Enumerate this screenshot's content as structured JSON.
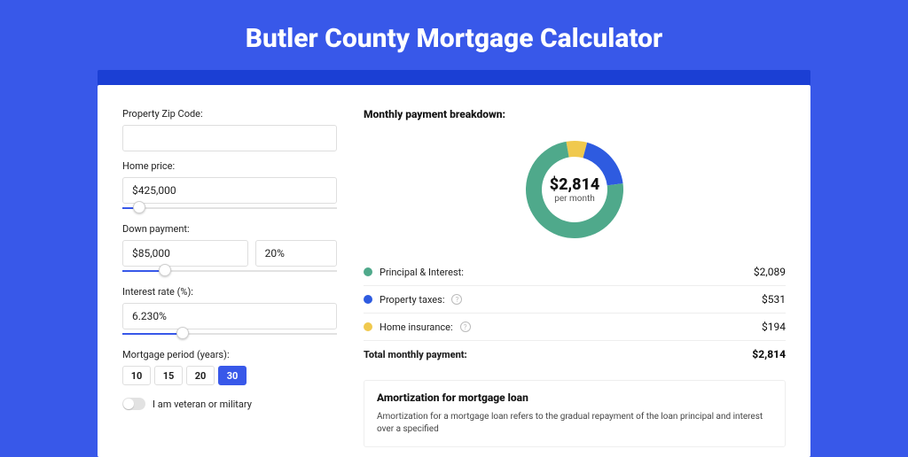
{
  "title": "Butler County Mortgage Calculator",
  "left": {
    "zip_label": "Property Zip Code:",
    "zip_value": "",
    "home_price_label": "Home price:",
    "home_price_value": "$425,000",
    "home_price_slider_pct": 8,
    "down_payment_label": "Down payment:",
    "down_payment_value": "$85,000",
    "down_payment_pct_value": "20%",
    "down_payment_slider_pct": 20,
    "rate_label": "Interest rate (%):",
    "rate_value": "6.230%",
    "rate_slider_pct": 28,
    "period_label": "Mortgage period (years):",
    "periods": [
      {
        "label": "10",
        "active": false
      },
      {
        "label": "15",
        "active": false
      },
      {
        "label": "20",
        "active": false
      },
      {
        "label": "30",
        "active": true
      }
    ],
    "veteran_label": "I am veteran or military"
  },
  "right": {
    "breakdown_title": "Monthly payment breakdown:",
    "donut": {
      "amount": "$2,814",
      "sub": "per month",
      "segments": [
        {
          "name": "Principal & Interest",
          "value": 2089,
          "color": "#4fa98b"
        },
        {
          "name": "Property taxes",
          "value": 531,
          "color": "#2e5be0"
        },
        {
          "name": "Home insurance",
          "value": 194,
          "color": "#f0c94e"
        }
      ]
    },
    "legend": [
      {
        "dot": "#4fa98b",
        "label": "Principal & Interest:",
        "value": "$2,089",
        "info": false
      },
      {
        "dot": "#2e5be0",
        "label": "Property taxes:",
        "value": "$531",
        "info": true
      },
      {
        "dot": "#f0c94e",
        "label": "Home insurance:",
        "value": "$194",
        "info": true
      }
    ],
    "total_label": "Total monthly payment:",
    "total_value": "$2,814",
    "amort_title": "Amortization for mortgage loan",
    "amort_body": "Amortization for a mortgage loan refers to the gradual repayment of the loan principal and interest over a specified"
  }
}
